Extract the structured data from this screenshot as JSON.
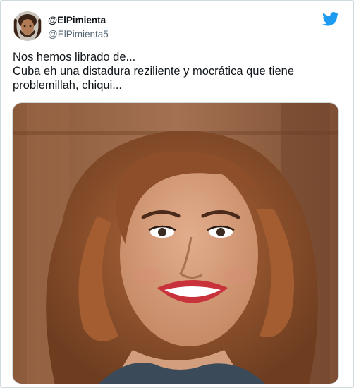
{
  "author": {
    "display_name": "@ElPimienta",
    "handle": "@ElPimienta5",
    "avatar_icon": "bearded-man-avatar",
    "verified": false
  },
  "brand": {
    "icon": "twitter-bird-icon",
    "color": "#1d9bf0"
  },
  "tweet": {
    "lines": [
      "Nos hemos librado de...",
      "Cuba eh una distadura reziliente y mocrática que tiene",
      "problemillah, chiqui..."
    ]
  },
  "media": {
    "kind": "photo",
    "subject": "smiling-woman-portrait"
  },
  "colors": {
    "text_primary": "#0f1419",
    "text_secondary": "#536471",
    "border": "#cfd9de"
  }
}
